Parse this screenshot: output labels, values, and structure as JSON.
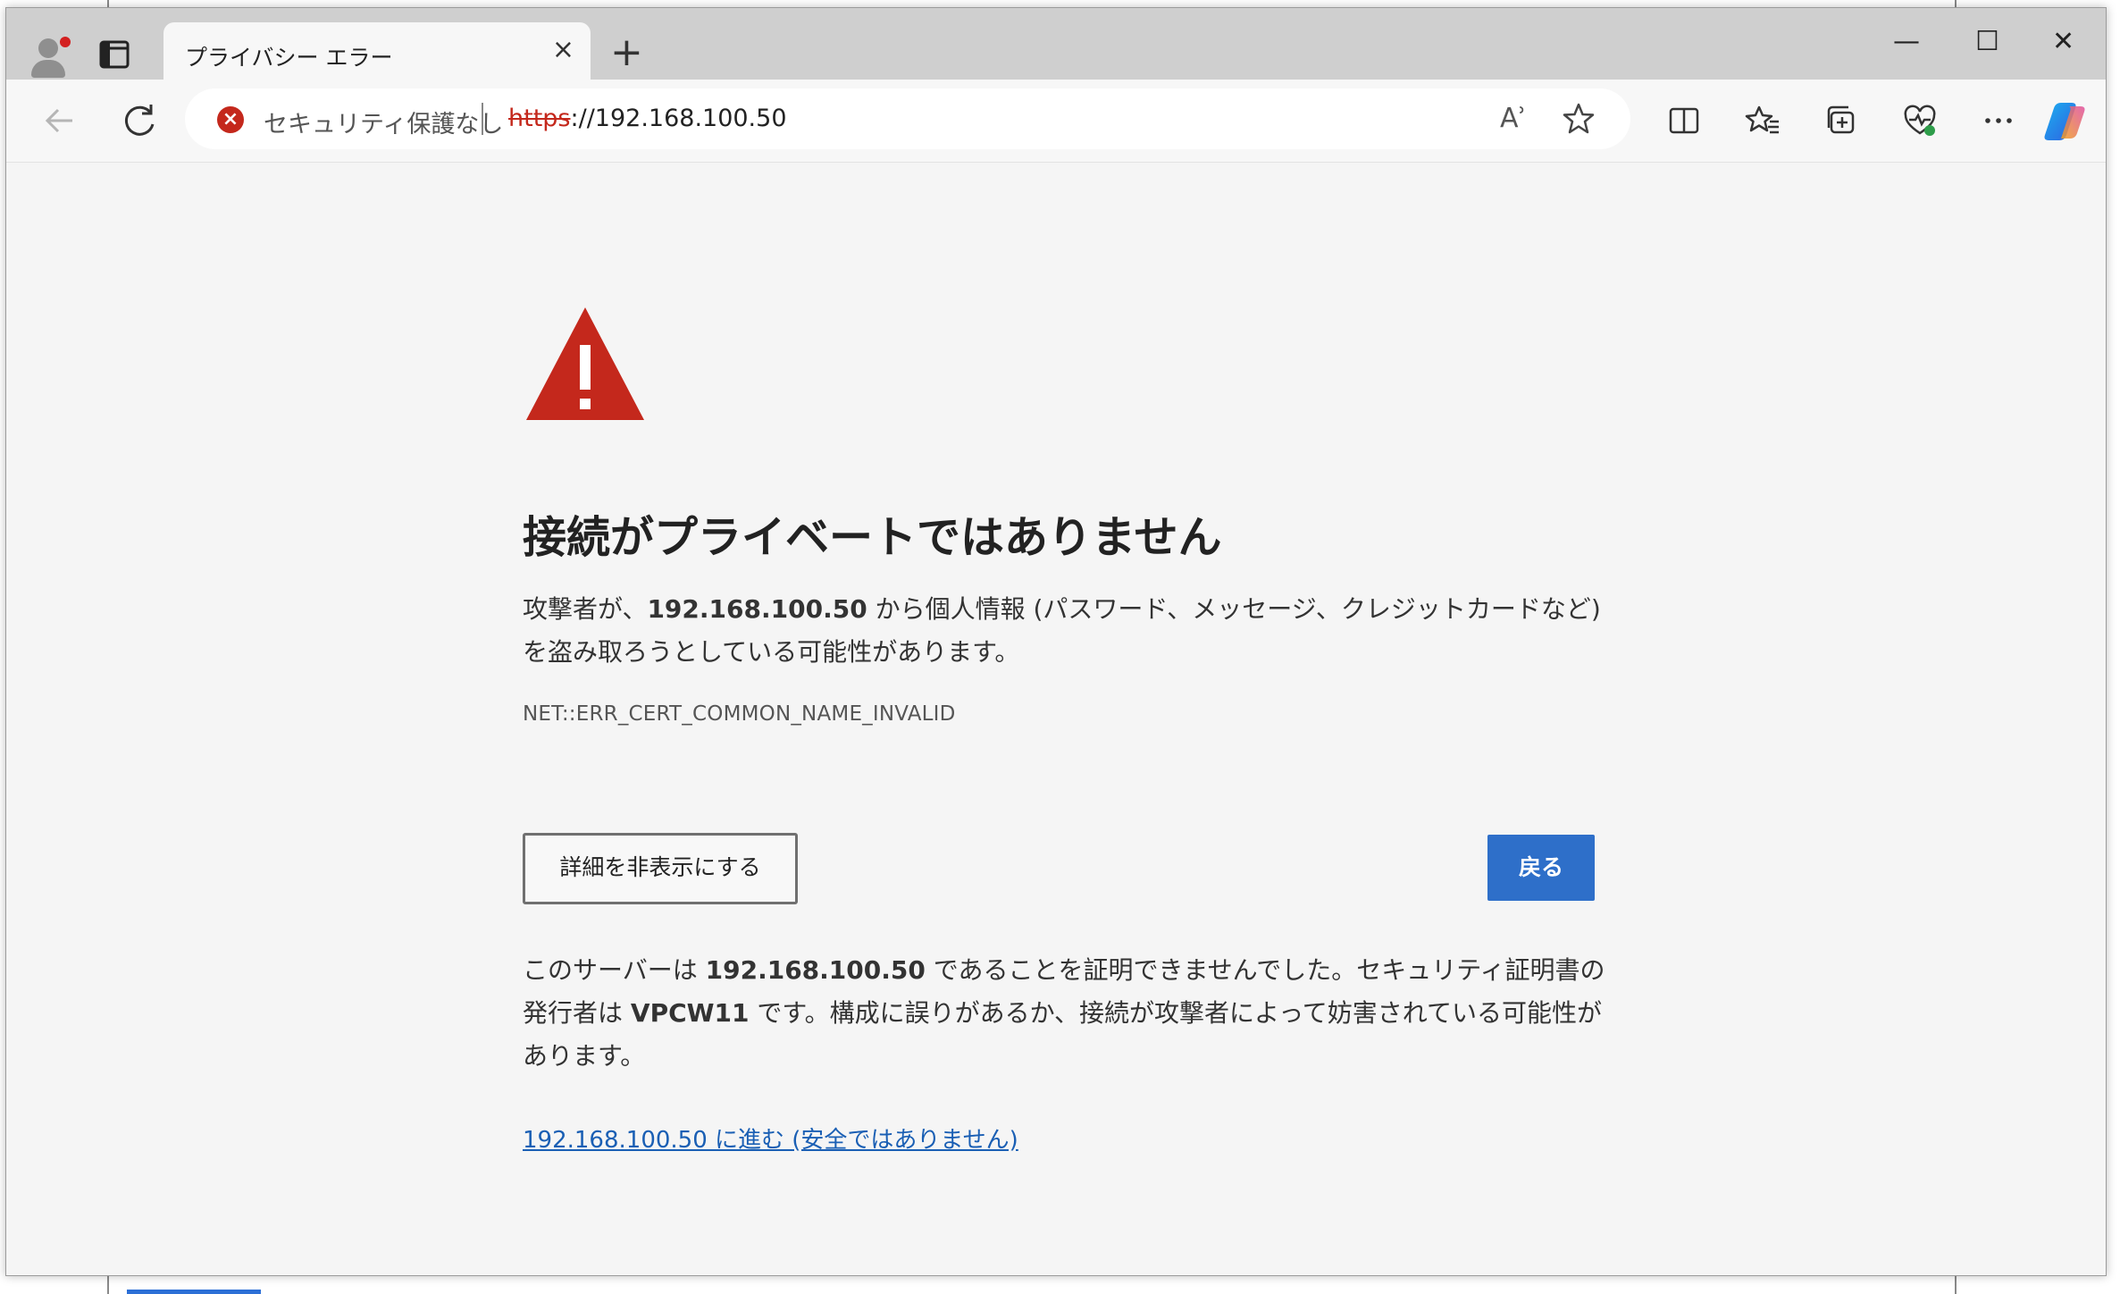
{
  "window": {
    "tab_title": "プライバシー エラー",
    "tab_close": "×",
    "new_tab": "+",
    "controls": {
      "minimize": "—",
      "maximize": "☐",
      "close": "✕"
    }
  },
  "address_bar": {
    "security_label": "セキュリティ保護なし",
    "url_scheme": "https",
    "url_rest": "://192.168.100.50",
    "read_aloud": "Aʾ"
  },
  "error_page": {
    "title": "接続がプライベートではありません",
    "description": {
      "pre": "攻撃者が、",
      "host": "192.168.100.50",
      "post": " から個人情報 (パスワード、メッセージ、クレジットカードなど) を盗み取ろうとしている可能性があります。"
    },
    "error_code": "NET::ERR_CERT_COMMON_NAME_INVALID",
    "hide_details_button": "詳細を非表示にする",
    "back_button": "戻る",
    "details": {
      "p1": "このサーバーは ",
      "host": "192.168.100.50",
      "p2": " であることを証明できませんでした。セキュリティ証明書の発行者は ",
      "issuer": "VPCW11",
      "p3": " です。構成に誤りがあるか、接続が攻撃者によって妨害されている可能性があります。"
    },
    "proceed_link": "192.168.100.50 に進む (安全ではありません)"
  },
  "colors": {
    "warning_red": "#c4281c",
    "primary_blue": "#2e6fc9",
    "link_blue": "#1a5fb4"
  },
  "icons": [
    "profile-icon",
    "tab-actions-icon",
    "back-arrow-icon",
    "refresh-icon",
    "not-secure-icon",
    "read-aloud-icon",
    "favorite-star-icon",
    "split-screen-icon",
    "favorites-icon",
    "collections-icon",
    "browser-essentials-icon",
    "more-icon",
    "copilot-icon",
    "warning-triangle-icon"
  ]
}
